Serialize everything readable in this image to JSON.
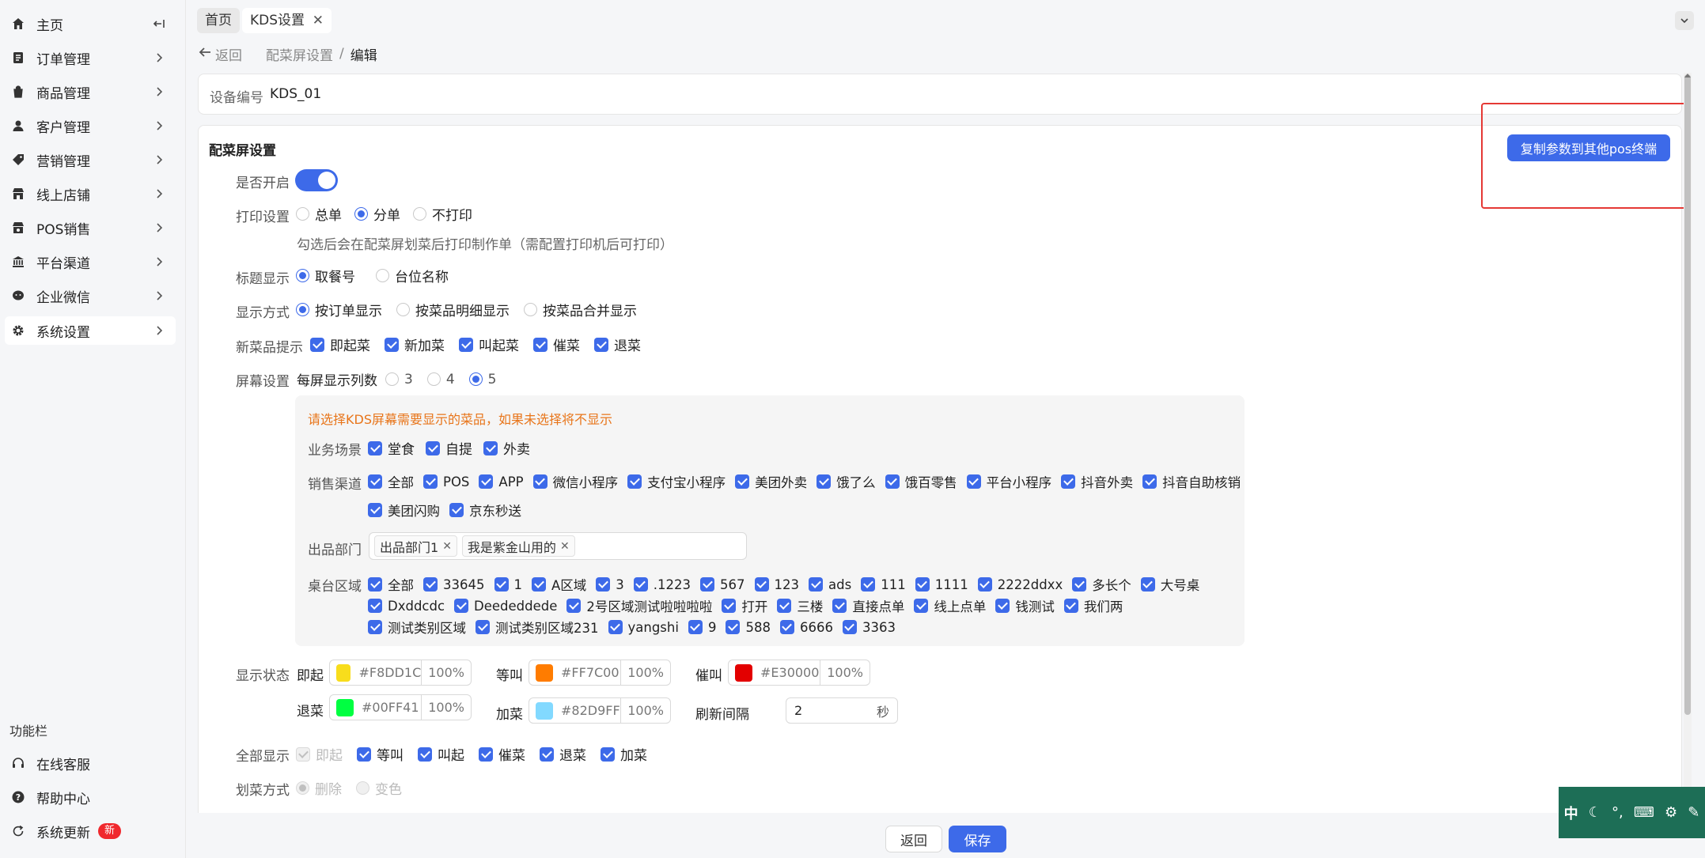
{
  "sidebar": {
    "items": [
      {
        "label": "主页",
        "icon": "home-icon"
      },
      {
        "label": "订单管理",
        "icon": "order-icon"
      },
      {
        "label": "商品管理",
        "icon": "product-icon"
      },
      {
        "label": "客户管理",
        "icon": "user-icon"
      },
      {
        "label": "营销管理",
        "icon": "tag-icon"
      },
      {
        "label": "线上店铺",
        "icon": "store-icon"
      },
      {
        "label": "POS销售",
        "icon": "pos-icon"
      },
      {
        "label": "平台渠道",
        "icon": "bank-icon"
      },
      {
        "label": "企业微信",
        "icon": "wechat-icon"
      },
      {
        "label": "系统设置",
        "icon": "gear-icon"
      }
    ],
    "func_title": "功能栏",
    "func_items": [
      {
        "label": "在线客服",
        "icon": "headset-icon"
      },
      {
        "label": "帮助中心",
        "icon": "help-icon"
      },
      {
        "label": "系统更新",
        "icon": "refresh-icon",
        "badge": "新"
      }
    ]
  },
  "tabs": [
    {
      "label": "首页"
    },
    {
      "label": "KDS设置"
    }
  ],
  "breadcrumb": {
    "back": "返回",
    "parent": "配菜屏设置",
    "sep": "/",
    "current": "编辑"
  },
  "device": {
    "label": "设备编号",
    "value": "KDS_01"
  },
  "section": {
    "title": "配菜屏设置",
    "copy_button": "复制参数到其他pos终端"
  },
  "form": {
    "enable_label": "是否开启",
    "print_label": "打印设置",
    "print_options": [
      "总单",
      "分单",
      "不打印"
    ],
    "print_hint": "勾选后会在配菜屏划菜后打印制作单（需配置打印机后可打印）",
    "title_label": "标题显示",
    "title_options": [
      "取餐号",
      "台位名称"
    ],
    "display_label": "显示方式",
    "display_options": [
      "按订单显示",
      "按菜品明细显示",
      "按菜品合并显示"
    ],
    "new_label": "新菜品提示",
    "new_options": [
      "即起菜",
      "新加菜",
      "叫起菜",
      "催菜",
      "退菜"
    ],
    "screen_label": "屏幕设置",
    "columns_label": "每屏显示列数",
    "columns_options": [
      "3",
      "4",
      "5"
    ],
    "warning": "请选择KDS屏幕需要显示的菜品，如果未选择将不显示",
    "scene_label": "业务场景",
    "scene_options": [
      "堂食",
      "自提",
      "外卖"
    ],
    "channel_label": "销售渠道",
    "channel_row1": [
      "全部",
      "POS",
      "APP",
      "微信小程序",
      "支付宝小程序",
      "美团外卖",
      "饿了么",
      "饿百零售",
      "平台小程序",
      "抖音外卖",
      "抖音自助核销"
    ],
    "channel_row2": [
      "美团闪购",
      "京东秒送"
    ],
    "dept_label": "出品部门",
    "dept_tags": [
      "出品部门1",
      "我是紫金山用的"
    ],
    "table_label": "桌台区域",
    "table_row1": [
      "全部",
      "33645",
      "1",
      "A区域",
      "3",
      ".1223",
      "567",
      "123",
      "ads",
      "111",
      "1111",
      "2222ddxx",
      "多长个",
      "大号桌"
    ],
    "table_row2": [
      "Dxddcdc",
      "Deededdede",
      "2号区域测试啦啦啦啦",
      "打开",
      "三楼",
      "直接点单",
      "线上点单",
      "钱测试",
      "我们两"
    ],
    "table_row3": [
      "测试类别区域",
      "测试类别区域231",
      "yangshi",
      "9",
      "588",
      "6666",
      "3363"
    ],
    "status_label": "显示状态",
    "status": [
      {
        "name": "即起",
        "hex": "#F8DD1C",
        "pct": "100%",
        "color": "#F8DD1C"
      },
      {
        "name": "等叫",
        "hex": "#FF7C00",
        "pct": "100%",
        "color": "#FF7C00"
      },
      {
        "name": "催叫",
        "hex": "#E30000",
        "pct": "100%",
        "color": "#E30000"
      },
      {
        "name": "退菜",
        "hex": "#00FF41",
        "pct": "100%",
        "color": "#00FF41"
      },
      {
        "name": "加菜",
        "hex": "#82D9FF",
        "pct": "100%",
        "color": "#82D9FF"
      }
    ],
    "refresh_label": "刷新间隔",
    "refresh_value": "2",
    "refresh_unit": "秒",
    "all_label": "全部显示",
    "all_options": [
      "即起",
      "等叫",
      "叫起",
      "催菜",
      "退菜",
      "加菜"
    ],
    "strike_label": "划菜方式",
    "strike_options": [
      "删除",
      "变色"
    ]
  },
  "footer": {
    "back": "返回",
    "save": "保存"
  },
  "ime": {
    "lang": "中"
  },
  "accent": "#3d6ae9"
}
